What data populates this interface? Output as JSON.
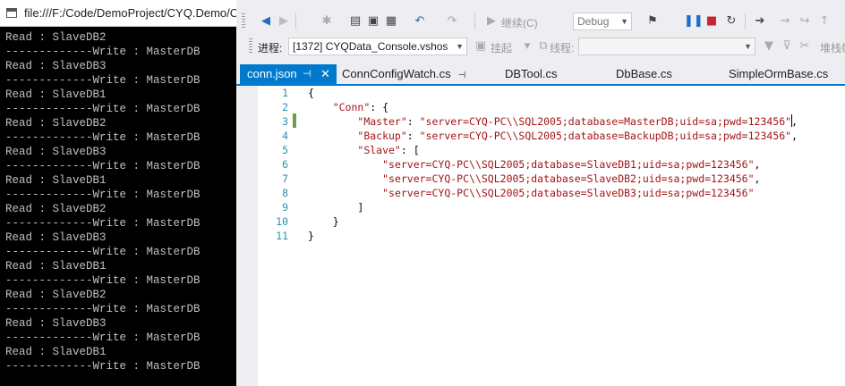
{
  "console": {
    "title": "file:///F:/Code/DemoProject/CYQ.Demo/C",
    "lines": [
      "Read : SlaveDB2",
      "-------------Write : MasterDB",
      "Read : SlaveDB3",
      "-------------Write : MasterDB",
      "Read : SlaveDB1",
      "-------------Write : MasterDB",
      "Read : SlaveDB2",
      "-------------Write : MasterDB",
      "Read : SlaveDB3",
      "-------------Write : MasterDB",
      "Read : SlaveDB1",
      "-------------Write : MasterDB",
      "Read : SlaveDB2",
      "-------------Write : MasterDB",
      "Read : SlaveDB3",
      "-------------Write : MasterDB",
      "Read : SlaveDB1",
      "-------------Write : MasterDB",
      "Read : SlaveDB2",
      "-------------Write : MasterDB",
      "Read : SlaveDB3",
      "-------------Write : MasterDB",
      "Read : SlaveDB1",
      "-------------Write : MasterDB"
    ]
  },
  "toolbar": {
    "continue_label": "继续(C)",
    "config_combo": "Debug",
    "process_label": "进程:",
    "process_value": "[1372] CYQData_Console.vshos",
    "suspend_label": "挂起",
    "thread_label": "线程:",
    "stack_label": "堆栈帧"
  },
  "tabs": [
    {
      "label": "conn.json",
      "active": true
    },
    {
      "label": "ConnConfigWatch.cs",
      "active": false
    },
    {
      "label": "DBTool.cs",
      "active": false
    },
    {
      "label": "DbBase.cs",
      "active": false
    },
    {
      "label": "SimpleOrmBase.cs",
      "active": false
    }
  ],
  "editor": {
    "line_numbers": [
      "1",
      "2",
      "3",
      "4",
      "5",
      "6",
      "7",
      "8",
      "9",
      "10",
      "11"
    ],
    "lines": [
      "{",
      "    \"Conn\": {",
      "        \"Master\": \"server=CYQ-PC\\\\SQL2005;database=MasterDB;uid=sa;pwd=123456\",",
      "        \"Backup\": \"server=CYQ-PC\\\\SQL2005;database=BackupDB;uid=sa;pwd=123456\",",
      "        \"Slave\": [",
      "            \"server=CYQ-PC\\\\SQL2005;database=SlaveDB1;uid=sa;pwd=123456\",",
      "            \"server=CYQ-PC\\\\SQL2005;database=SlaveDB2;uid=sa;pwd=123456\",",
      "            \"server=CYQ-PC\\\\SQL2005;database=SlaveDB3;uid=sa;pwd=123456\"",
      "        ]",
      "    }",
      "}"
    ]
  },
  "colors": {
    "accent": "#007acc",
    "line_number": "#2b91af",
    "string": "#a31515",
    "change_marker": "#6c9e50"
  }
}
